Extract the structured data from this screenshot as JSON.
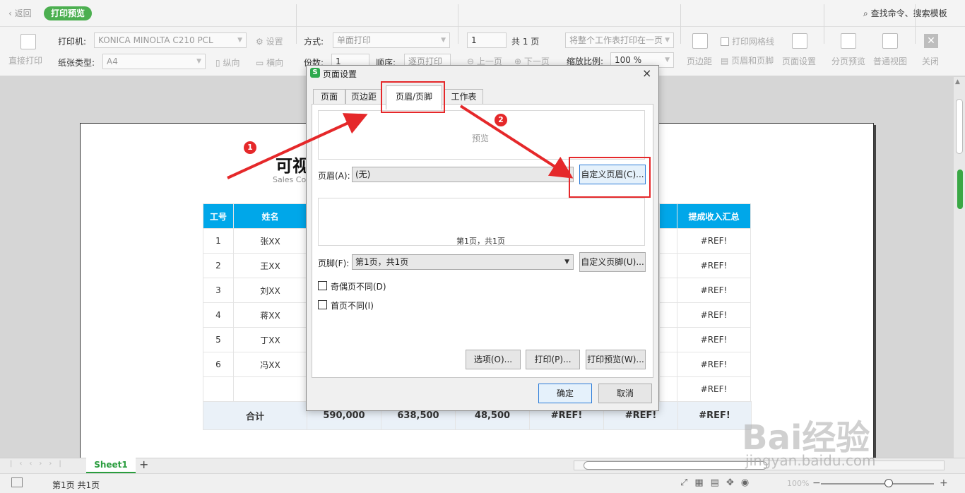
{
  "titlebar": {
    "back": "返回",
    "badge": "打印预览",
    "search": "查找命令、搜索模板"
  },
  "toolbar": {
    "direct_print": "直接打印",
    "printer_label": "打印机:",
    "printer_value": "KONICA MINOLTA C210 PCL",
    "settings": "设置",
    "paper_label": "纸张类型:",
    "paper_value": "A4",
    "portrait": "纵向",
    "landscape": "横向",
    "mode_label": "方式:",
    "mode_value": "单面打印",
    "copies_label": "份数:",
    "copies_value": "1",
    "order_label": "顺序:",
    "order_value": "逐页打印",
    "page_value": "1",
    "page_total": "共 1 页",
    "prev_page": "上一页",
    "next_page": "下一页",
    "fit_value": "将整个工作表打印在一页",
    "zoom_label": "缩放比例:",
    "zoom_value": "100 %",
    "margin": "页边距",
    "print_grid": "打印网格线",
    "header_footer": "页眉和页脚",
    "page_setup": "页面设置",
    "page_break_preview": "分页预览",
    "normal_view": "普通视图",
    "close": "关闭"
  },
  "sheet": {
    "title": "可视",
    "subtitle": "Sales Co",
    "headers": {
      "id": "工号",
      "name": "姓名",
      "commission": "提成收入汇总"
    },
    "rows": [
      {
        "id": "1",
        "name": "张XX",
        "value": "#REF!"
      },
      {
        "id": "2",
        "name": "王XX",
        "value": "#REF!"
      },
      {
        "id": "3",
        "name": "刘XX",
        "value": "#REF!"
      },
      {
        "id": "4",
        "name": "蒋XX",
        "value": "#REF!"
      },
      {
        "id": "5",
        "name": "丁XX",
        "value": "#REF!"
      },
      {
        "id": "6",
        "name": "冯XX",
        "value": "#REF!"
      },
      {
        "id": "",
        "name": "",
        "value": "#REF!"
      }
    ],
    "total": {
      "label": "合计",
      "c1": "590,000",
      "c2": "638,500",
      "c3": "48,500",
      "c4": "#REF!",
      "c5": "#REF!",
      "c6": "#REF!"
    }
  },
  "dialog": {
    "title": "页面设置",
    "logo": "S",
    "close": "×",
    "tabs": [
      "页面",
      "页边距",
      "页眉/页脚",
      "工作表"
    ],
    "preview_text": "预览",
    "header_label": "页眉(A):",
    "header_value": "(无)",
    "custom_header": "自定义页眉(C)...",
    "footer_preview_text": "第1页，共1页",
    "footer_label": "页脚(F):",
    "footer_value": "第1页，共1页",
    "custom_footer": "自定义页脚(U)...",
    "odd_even": "奇偶页不同(D)",
    "first_page": "首页不同(I)",
    "options": "选项(O)...",
    "print": "打印(P)...",
    "print_preview": "打印预览(W)...",
    "ok": "确定",
    "cancel": "取消"
  },
  "bottom": {
    "sheet_tab": "Sheet1",
    "add_sheet": "+",
    "status_page": "第1页 共1页",
    "zoom": "100%"
  },
  "annotations": {
    "step1": "1",
    "step2": "2",
    "accent_color": "#e5282a"
  },
  "watermark": {
    "brand": "Bai经验",
    "url": "jingyan.baidu.com"
  }
}
